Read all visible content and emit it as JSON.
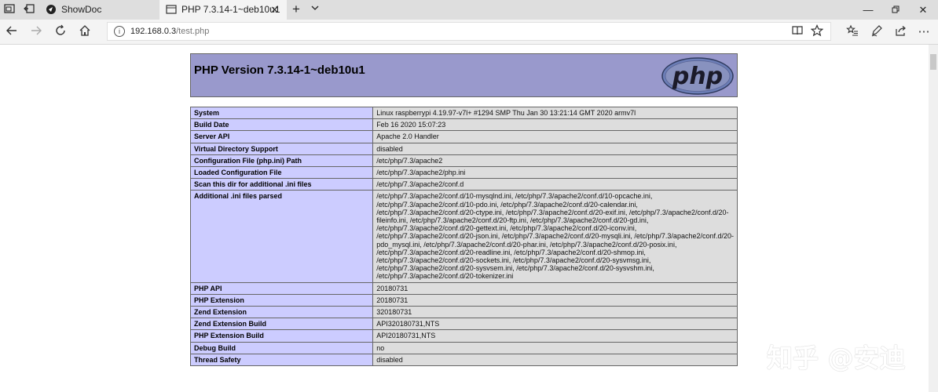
{
  "browser": {
    "tabs": [
      {
        "label": "ShowDoc",
        "active": false
      },
      {
        "label": "PHP 7.3.14-1~deb10u1",
        "active": true
      }
    ],
    "address": {
      "host": "192.168.0.3",
      "path": "/test.php"
    }
  },
  "page": {
    "title": "PHP Version 7.3.14-1~deb10u1",
    "logo_text": "php",
    "rows": [
      {
        "key": "System",
        "lines": [
          "Linux raspberrypi 4.19.97-v7l+ #1294 SMP Thu Jan 30 13:21:14 GMT 2020 armv7l"
        ]
      },
      {
        "key": "Build Date",
        "lines": [
          "Feb 16 2020 15:07:23"
        ]
      },
      {
        "key": "Server API",
        "lines": [
          "Apache 2.0 Handler"
        ]
      },
      {
        "key": "Virtual Directory Support",
        "lines": [
          "disabled"
        ]
      },
      {
        "key": "Configuration File (php.ini) Path",
        "lines": [
          "/etc/php/7.3/apache2"
        ]
      },
      {
        "key": "Loaded Configuration File",
        "lines": [
          "/etc/php/7.3/apache2/php.ini"
        ]
      },
      {
        "key": "Scan this dir for additional .ini files",
        "lines": [
          "/etc/php/7.3/apache2/conf.d"
        ]
      },
      {
        "key": "Additional .ini files parsed",
        "lines": [
          "/etc/php/7.3/apache2/conf.d/10-mysqlnd.ini, /etc/php/7.3/apache2/conf.d/10-opcache.ini,",
          "/etc/php/7.3/apache2/conf.d/10-pdo.ini, /etc/php/7.3/apache2/conf.d/20-calendar.ini,",
          "/etc/php/7.3/apache2/conf.d/20-ctype.ini, /etc/php/7.3/apache2/conf.d/20-exif.ini, /etc/php/7.3/apache2/conf.d/20-",
          "fileinfo.ini, /etc/php/7.3/apache2/conf.d/20-ftp.ini, /etc/php/7.3/apache2/conf.d/20-gd.ini,",
          "/etc/php/7.3/apache2/conf.d/20-gettext.ini, /etc/php/7.3/apache2/conf.d/20-iconv.ini,",
          "/etc/php/7.3/apache2/conf.d/20-json.ini, /etc/php/7.3/apache2/conf.d/20-mysqli.ini, /etc/php/7.3/apache2/conf.d/20-",
          "pdo_mysql.ini, /etc/php/7.3/apache2/conf.d/20-phar.ini, /etc/php/7.3/apache2/conf.d/20-posix.ini,",
          "/etc/php/7.3/apache2/conf.d/20-readline.ini, /etc/php/7.3/apache2/conf.d/20-shmop.ini,",
          "/etc/php/7.3/apache2/conf.d/20-sockets.ini, /etc/php/7.3/apache2/conf.d/20-sysvmsg.ini,",
          "/etc/php/7.3/apache2/conf.d/20-sysvsem.ini, /etc/php/7.3/apache2/conf.d/20-sysvshm.ini,",
          "/etc/php/7.3/apache2/conf.d/20-tokenizer.ini"
        ]
      },
      {
        "key": "PHP API",
        "lines": [
          "20180731"
        ]
      },
      {
        "key": "PHP Extension",
        "lines": [
          "20180731"
        ]
      },
      {
        "key": "Zend Extension",
        "lines": [
          "320180731"
        ]
      },
      {
        "key": "Zend Extension Build",
        "lines": [
          "API320180731,NTS"
        ]
      },
      {
        "key": "PHP Extension Build",
        "lines": [
          "API20180731,NTS"
        ]
      },
      {
        "key": "Debug Build",
        "lines": [
          "no"
        ]
      },
      {
        "key": "Thread Safety",
        "lines": [
          "disabled"
        ]
      }
    ]
  },
  "watermark": "知乎 @安迪",
  "colors": {
    "header_bg": "#9999cc",
    "key_bg": "#ccccff",
    "value_bg": "#dddddd"
  }
}
